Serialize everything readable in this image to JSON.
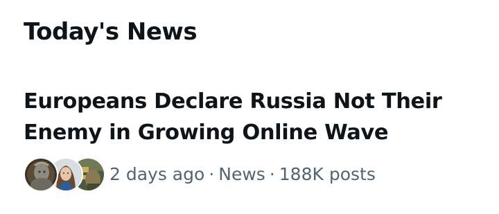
{
  "section": {
    "title": "Today's News"
  },
  "story": {
    "headline": "Europeans Declare Russia Not Their Enemy in Growing Online Wave",
    "time": "2 days ago",
    "category": "News",
    "posts": "188K posts",
    "separator": "·",
    "avatars": [
      {
        "icon": "user-avatar-statue"
      },
      {
        "icon": "user-avatar-woman"
      },
      {
        "icon": "user-avatar-soldier"
      }
    ]
  },
  "colors": {
    "text_primary": "#0f1419",
    "text_secondary": "#536471",
    "background": "#ffffff"
  }
}
